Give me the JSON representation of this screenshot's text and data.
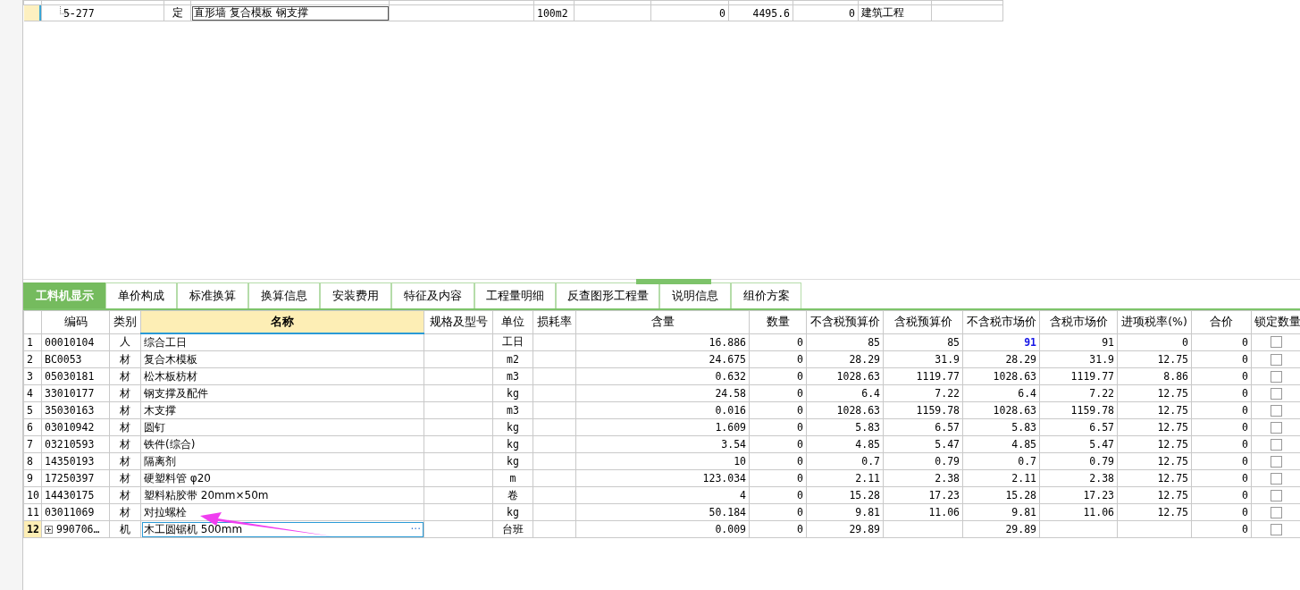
{
  "top_table": {
    "rows": [
      {
        "code": "5-277",
        "type": "定",
        "name": "直形墙 复合模板 钢支撑",
        "column_4": "",
        "unit": "100m2",
        "column_6": "",
        "column_7": "0",
        "column_8": "4495.6",
        "column_9": "0",
        "column_10": "建筑工程",
        "selected": true
      }
    ]
  },
  "tabs": [
    {
      "label": "工料机显示",
      "selected": true
    },
    {
      "label": "单价构成",
      "selected": false
    },
    {
      "label": "标准换算",
      "selected": false
    },
    {
      "label": "换算信息",
      "selected": false
    },
    {
      "label": "安装费用",
      "selected": false
    },
    {
      "label": "特征及内容",
      "selected": false
    },
    {
      "label": "工程量明细",
      "selected": false
    },
    {
      "label": "反查图形工程量",
      "selected": false
    },
    {
      "label": "说明信息",
      "selected": false
    },
    {
      "label": "组价方案",
      "selected": false
    }
  ],
  "grid": {
    "columns": [
      "编码",
      "类别",
      "名称",
      "规格及型号",
      "单位",
      "损耗率",
      "含量",
      "数量",
      "不含税预算价",
      "含税预算价",
      "不含税市场价",
      "含税市场价",
      "进项税率(%)",
      "合价",
      "锁定数量"
    ],
    "rows": [
      {
        "no": "1",
        "code": "00010104",
        "type": "人",
        "name": "综合工日",
        "spec": "",
        "unit": "工日",
        "loss": "",
        "content": "16.886",
        "quantity": "0",
        "budget_ex": "85",
        "budget_in": "85",
        "market_ex": "91",
        "market_in": "91",
        "tax_rate": "0",
        "total": "0",
        "market_changed": true,
        "locked": false,
        "selected": false
      },
      {
        "no": "2",
        "code": "BC0053",
        "type": "材",
        "name": "复合木模板",
        "spec": "",
        "unit": "m2",
        "loss": "",
        "content": "24.675",
        "quantity": "0",
        "budget_ex": "28.29",
        "budget_in": "31.9",
        "market_ex": "28.29",
        "market_in": "31.9",
        "tax_rate": "12.75",
        "total": "0",
        "market_changed": false,
        "locked": false,
        "selected": false
      },
      {
        "no": "3",
        "code": "05030181",
        "type": "材",
        "name": "松木板枋材",
        "spec": "",
        "unit": "m3",
        "loss": "",
        "content": "0.632",
        "quantity": "0",
        "budget_ex": "1028.63",
        "budget_in": "1119.77",
        "market_ex": "1028.63",
        "market_in": "1119.77",
        "tax_rate": "8.86",
        "total": "0",
        "market_changed": false,
        "locked": false,
        "selected": false
      },
      {
        "no": "4",
        "code": "33010177",
        "type": "材",
        "name": "钢支撑及配件",
        "spec": "",
        "unit": "kg",
        "loss": "",
        "content": "24.58",
        "quantity": "0",
        "budget_ex": "6.4",
        "budget_in": "7.22",
        "market_ex": "6.4",
        "market_in": "7.22",
        "tax_rate": "12.75",
        "total": "0",
        "market_changed": false,
        "locked": false,
        "selected": false
      },
      {
        "no": "5",
        "code": "35030163",
        "type": "材",
        "name": "木支撑",
        "spec": "",
        "unit": "m3",
        "loss": "",
        "content": "0.016",
        "quantity": "0",
        "budget_ex": "1028.63",
        "budget_in": "1159.78",
        "market_ex": "1028.63",
        "market_in": "1159.78",
        "tax_rate": "12.75",
        "total": "0",
        "market_changed": false,
        "locked": false,
        "selected": false
      },
      {
        "no": "6",
        "code": "03010942",
        "type": "材",
        "name": "圆钉",
        "spec": "",
        "unit": "kg",
        "loss": "",
        "content": "1.609",
        "quantity": "0",
        "budget_ex": "5.83",
        "budget_in": "6.57",
        "market_ex": "5.83",
        "market_in": "6.57",
        "tax_rate": "12.75",
        "total": "0",
        "market_changed": false,
        "locked": false,
        "selected": false
      },
      {
        "no": "7",
        "code": "03210593",
        "type": "材",
        "name": "铁件(综合)",
        "spec": "",
        "unit": "kg",
        "loss": "",
        "content": "3.54",
        "quantity": "0",
        "budget_ex": "4.85",
        "budget_in": "5.47",
        "market_ex": "4.85",
        "market_in": "5.47",
        "tax_rate": "12.75",
        "total": "0",
        "market_changed": false,
        "locked": false,
        "selected": false
      },
      {
        "no": "8",
        "code": "14350193",
        "type": "材",
        "name": "隔离剂",
        "spec": "",
        "unit": "kg",
        "loss": "",
        "content": "10",
        "quantity": "0",
        "budget_ex": "0.7",
        "budget_in": "0.79",
        "market_ex": "0.7",
        "market_in": "0.79",
        "tax_rate": "12.75",
        "total": "0",
        "market_changed": false,
        "locked": false,
        "selected": false
      },
      {
        "no": "9",
        "code": "17250397",
        "type": "材",
        "name": "硬塑料管 φ20",
        "spec": "",
        "unit": "m",
        "loss": "",
        "content": "123.034",
        "quantity": "0",
        "budget_ex": "2.11",
        "budget_in": "2.38",
        "market_ex": "2.11",
        "market_in": "2.38",
        "tax_rate": "12.75",
        "total": "0",
        "market_changed": false,
        "locked": false,
        "selected": false
      },
      {
        "no": "10",
        "code": "14430175",
        "type": "材",
        "name": "塑料粘胶带 20mm×50m",
        "spec": "",
        "unit": "卷",
        "loss": "",
        "content": "4",
        "quantity": "0",
        "budget_ex": "15.28",
        "budget_in": "17.23",
        "market_ex": "15.28",
        "market_in": "17.23",
        "tax_rate": "12.75",
        "total": "0",
        "market_changed": false,
        "locked": false,
        "selected": false
      },
      {
        "no": "11",
        "code": "03011069",
        "type": "材",
        "name": "对拉螺栓",
        "spec": "",
        "unit": "kg",
        "loss": "",
        "content": "50.184",
        "quantity": "0",
        "budget_ex": "9.81",
        "budget_in": "11.06",
        "market_ex": "9.81",
        "market_in": "11.06",
        "tax_rate": "12.75",
        "total": "0",
        "market_changed": false,
        "locked": false,
        "selected": false
      },
      {
        "no": "12",
        "code": "990706…",
        "type": "机",
        "name": "木工圆锯机 500mm",
        "spec": "",
        "unit": "台班",
        "loss": "",
        "content": "0.009",
        "quantity": "0",
        "budget_ex": "29.89",
        "budget_in": "",
        "market_ex": "29.89",
        "market_in": "",
        "tax_rate": "",
        "total": "0",
        "market_changed": false,
        "locked": false,
        "selected": true,
        "expandable": true,
        "edit_button": "···"
      }
    ]
  }
}
